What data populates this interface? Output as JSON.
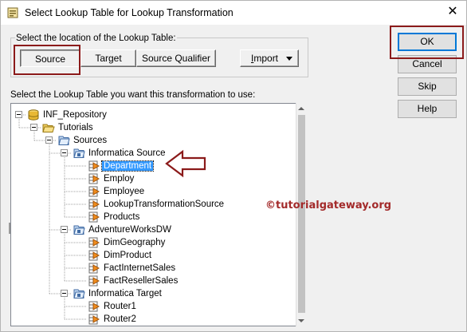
{
  "window": {
    "title": "Select Lookup Table for Lookup Transformation",
    "close_glyph": "✕"
  },
  "location": {
    "group_label": "Select the location of the Lookup Table:",
    "tabs": [
      {
        "label": "Source",
        "pressed": true
      },
      {
        "label": "Target",
        "pressed": false
      },
      {
        "label": "Source Qualifier",
        "pressed": false
      }
    ],
    "import_button": {
      "mnemonic": "I",
      "rest": "mport"
    }
  },
  "side_buttons": {
    "ok": "OK",
    "cancel": "Cancel",
    "skip": "Skip",
    "help": "Help"
  },
  "instruction": "Select the Lookup Table you want this transformation to use:",
  "tree": [
    {
      "label": "INF_Repository",
      "icon": "repository-icon",
      "level": 0,
      "expanded": true
    },
    {
      "label": "Tutorials",
      "icon": "open-folder-icon",
      "level": 1,
      "expanded": true
    },
    {
      "label": "Sources",
      "icon": "sources-folder-icon",
      "level": 2,
      "expanded": true
    },
    {
      "label": "Informatica Source",
      "icon": "database-folder-icon",
      "level": 3,
      "expanded": true
    },
    {
      "label": "Department",
      "icon": "source-table-icon",
      "level": 4,
      "selected": true
    },
    {
      "label": "Employ",
      "icon": "source-table-icon",
      "level": 4
    },
    {
      "label": "Employee",
      "icon": "source-table-icon",
      "level": 4
    },
    {
      "label": "LookupTransformationSource",
      "icon": "source-table-icon",
      "level": 4
    },
    {
      "label": "Products",
      "icon": "source-table-icon",
      "level": 4
    },
    {
      "label": "AdventureWorksDW",
      "icon": "database-folder-icon",
      "level": 3,
      "expanded": true
    },
    {
      "label": "DimGeography",
      "icon": "source-table-icon",
      "level": 4
    },
    {
      "label": "DimProduct",
      "icon": "source-table-icon",
      "level": 4
    },
    {
      "label": "FactInternetSales",
      "icon": "source-table-icon",
      "level": 4
    },
    {
      "label": "FactResellerSales",
      "icon": "source-table-icon",
      "level": 4
    },
    {
      "label": "Informatica Target",
      "icon": "database-folder-icon",
      "level": 3,
      "expanded": true
    },
    {
      "label": "Router1",
      "icon": "source-table-icon",
      "level": 4
    },
    {
      "label": "Router2",
      "icon": "source-table-icon",
      "level": 4
    }
  ],
  "watermark": "©tutorialgateway.org",
  "colors": {
    "annotation": "#8b1a1a",
    "selection": "#3399ff",
    "watermark": "#a32a2a"
  }
}
